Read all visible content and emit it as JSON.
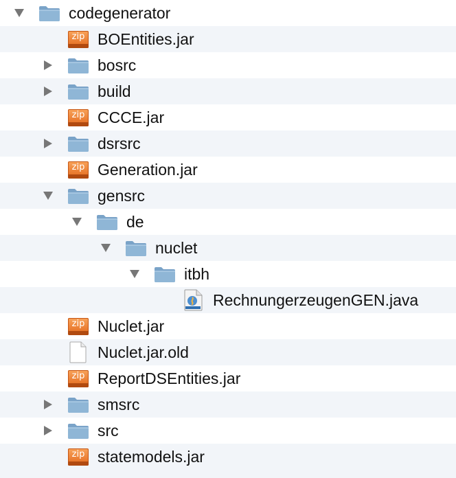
{
  "colors": {
    "row_alt": "#f2f5f9",
    "folder": "#8fb6d6",
    "zip": "#e3681c",
    "text": "#111111"
  },
  "tree": {
    "rows": [
      {
        "label": "codegenerator",
        "icon": "folder-icon",
        "toggle": "expanded",
        "depth": 0
      },
      {
        "label": "BOEntities.jar",
        "icon": "zip-icon",
        "toggle": "none",
        "depth": 1
      },
      {
        "label": "bosrc",
        "icon": "folder-icon",
        "toggle": "collapsed",
        "depth": 1
      },
      {
        "label": "build",
        "icon": "folder-icon",
        "toggle": "collapsed",
        "depth": 1
      },
      {
        "label": "CCCE.jar",
        "icon": "zip-icon",
        "toggle": "none",
        "depth": 1
      },
      {
        "label": "dsrsrc",
        "icon": "folder-icon",
        "toggle": "collapsed",
        "depth": 1
      },
      {
        "label": "Generation.jar",
        "icon": "zip-icon",
        "toggle": "none",
        "depth": 1
      },
      {
        "label": "gensrc",
        "icon": "folder-icon",
        "toggle": "expanded",
        "depth": 1
      },
      {
        "label": "de",
        "icon": "folder-icon",
        "toggle": "expanded",
        "depth": 2
      },
      {
        "label": "nuclet",
        "icon": "folder-icon",
        "toggle": "expanded",
        "depth": 3
      },
      {
        "label": "itbh",
        "icon": "folder-icon",
        "toggle": "expanded",
        "depth": 4
      },
      {
        "label": "RechnungerzeugenGEN.java",
        "icon": "java-file-icon",
        "toggle": "none",
        "depth": 5
      },
      {
        "label": "Nuclet.jar",
        "icon": "zip-icon",
        "toggle": "none",
        "depth": 1
      },
      {
        "label": "Nuclet.jar.old",
        "icon": "document-icon",
        "toggle": "none",
        "depth": 1
      },
      {
        "label": "ReportDSEntities.jar",
        "icon": "zip-icon",
        "toggle": "none",
        "depth": 1
      },
      {
        "label": "smsrc",
        "icon": "folder-icon",
        "toggle": "collapsed",
        "depth": 1
      },
      {
        "label": "src",
        "icon": "folder-icon",
        "toggle": "collapsed",
        "depth": 1
      },
      {
        "label": "statemodels.jar",
        "icon": "zip-icon",
        "toggle": "none",
        "depth": 1
      }
    ],
    "zip_badge": "zip"
  }
}
